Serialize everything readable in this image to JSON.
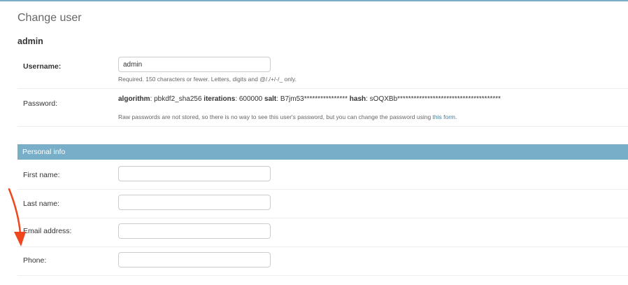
{
  "page": {
    "title": "Change user",
    "object_name": "admin"
  },
  "fields": {
    "username": {
      "label": "Username:",
      "value": "admin",
      "help": "Required. 150 characters or fewer. Letters, digits and @/./+/-/_ only."
    },
    "password": {
      "label": "Password:",
      "algorithm_label": "algorithm",
      "algorithm_value": ": pbkdf2_sha256 ",
      "iterations_label": "iterations",
      "iterations_value": ": 600000 ",
      "salt_label": "salt",
      "salt_value": ": B7jm53**************** ",
      "hash_label": "hash",
      "hash_value": ": sOQXBb**************************************",
      "help_prefix": "Raw passwords are not stored, so there is no way to see this user's password, but you can change the password using ",
      "help_link": "this form",
      "help_suffix": "."
    }
  },
  "personal_info": {
    "header": "Personal info",
    "first_name": {
      "label": "First name:",
      "value": ""
    },
    "last_name": {
      "label": "Last name:",
      "value": ""
    },
    "email": {
      "label": "Email address:",
      "value": ""
    },
    "phone": {
      "label": "Phone:",
      "value": ""
    }
  },
  "colors": {
    "header_blue": "#79aec8",
    "link_blue": "#447e9b",
    "annotation_arrow": "#f0461e"
  }
}
